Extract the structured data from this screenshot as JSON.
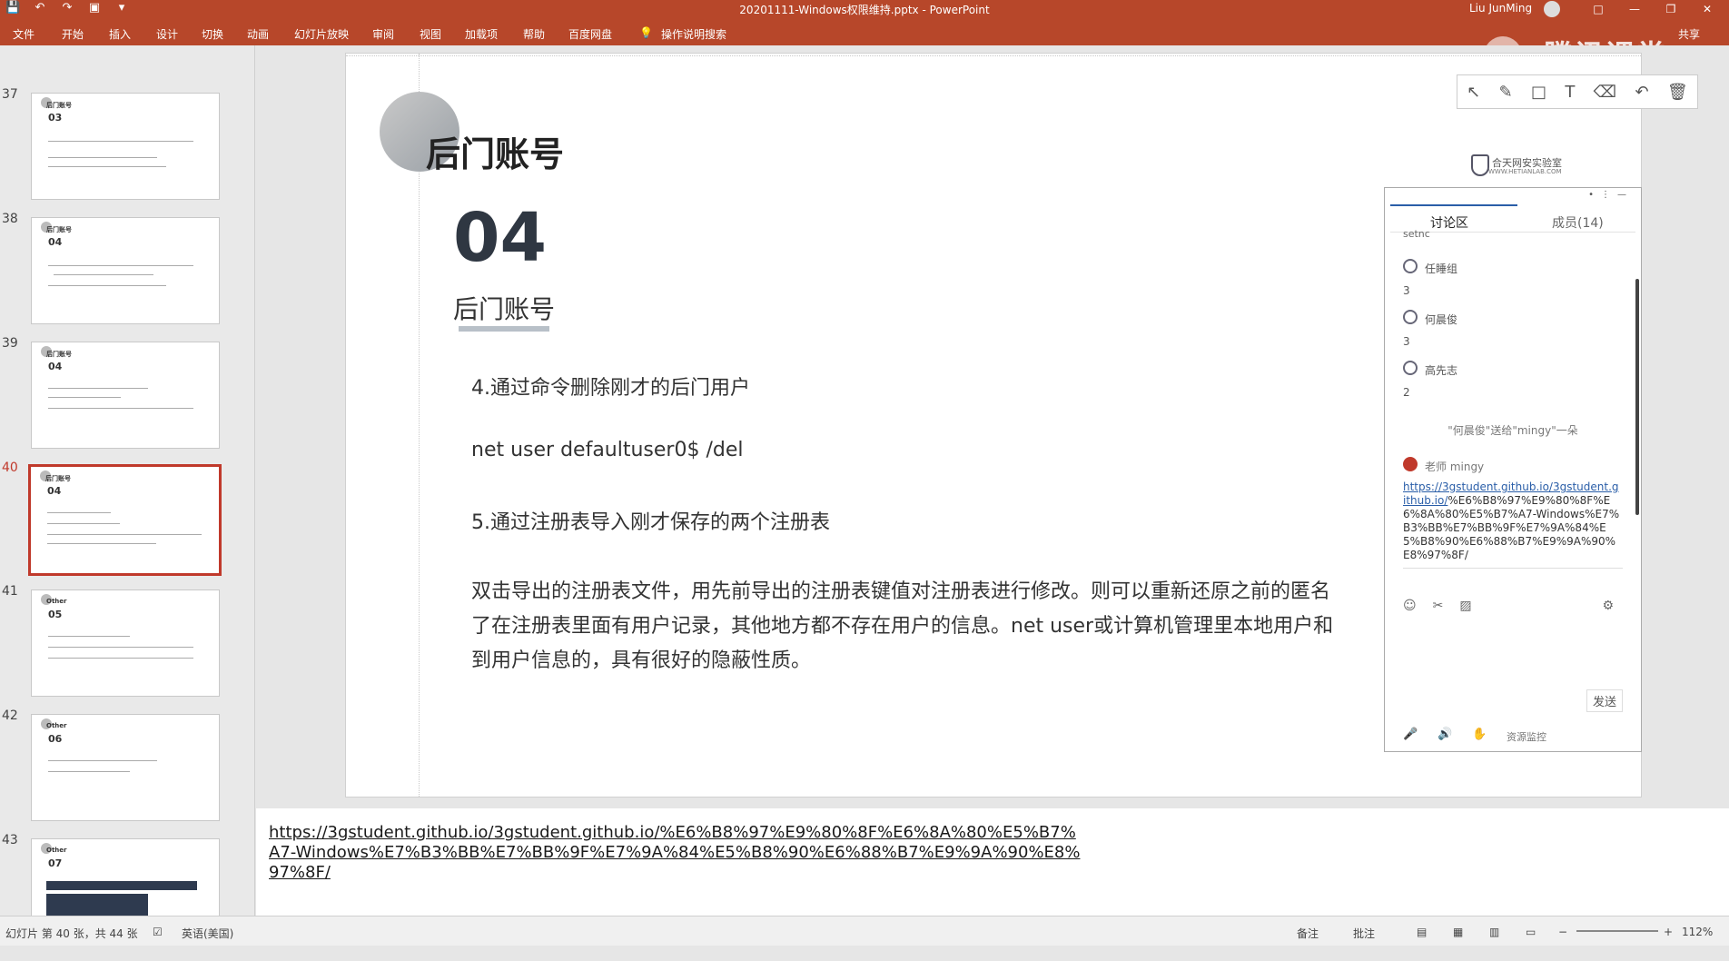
{
  "titlebar": {
    "doc_title": "20201111-Windows权限维持.pptx  -  PowerPoint",
    "user": "Liu JunMing",
    "quick_access": [
      "save-icon",
      "undo-icon",
      "redo-icon",
      "start-presentation-icon",
      "customize-icon"
    ],
    "win_buttons": [
      "□",
      "—",
      "❐",
      "✕"
    ]
  },
  "ribbon": {
    "tabs": [
      "文件",
      "开始",
      "插入",
      "设计",
      "切换",
      "动画",
      "幻灯片放映",
      "审阅",
      "视图",
      "加载项",
      "帮助",
      "百度网盘",
      "操作说明搜索"
    ],
    "share": "共享"
  },
  "watermark": "腾讯课堂",
  "thumbnails": [
    {
      "num": "37",
      "label": "后门账号",
      "section": "03",
      "selected": false
    },
    {
      "num": "38",
      "label": "后门账号",
      "section": "04",
      "selected": false
    },
    {
      "num": "39",
      "label": "后门账号",
      "section": "04",
      "selected": false
    },
    {
      "num": "40",
      "label": "后门账号",
      "section": "04",
      "selected": true
    },
    {
      "num": "41",
      "label": "Other",
      "section": "05",
      "selected": false
    },
    {
      "num": "42",
      "label": "Other",
      "section": "06",
      "selected": false
    },
    {
      "num": "43",
      "label": "Other",
      "section": "07",
      "selected": false
    }
  ],
  "slide": {
    "heading": "后门账号",
    "number": "04",
    "subtitle": "后门账号",
    "brand": "合天网安实验室",
    "brand_sub": "WWW.HETIANLAB.COM",
    "lines": [
      "4.通过命令删除刚才的后门用户",
      "net user defaultuser0$ /del",
      "5.通过注册表导入刚才保存的两个注册表",
      "双击导出的注册表文件，用先前导出的注册表键值对注册表进行修改。则可以重新还原之前的匿名",
      "了在注册表里面有用户记录，其他地方都不存在用户的信息。net user或计算机管理里本地用户和",
      "到用户信息的，具有很好的隐蔽性质。"
    ]
  },
  "annotation_toolbar": [
    "pointer-icon",
    "pen-icon",
    "rectangle-icon",
    "text-icon",
    "eraser-icon",
    "undo-icon",
    "delete-icon"
  ],
  "chat": {
    "tab_discussion": "讨论区",
    "tab_members": "成员(14)",
    "fragment": "setnc",
    "entries": [
      {
        "name": "任睡组",
        "msg": "3"
      },
      {
        "name": "何晨俊",
        "msg": "3"
      },
      {
        "name": "高先志",
        "msg": "2"
      }
    ],
    "notice": "\"何晨俊\"送给\"mingy\"一朵",
    "teacher": "老师  mingy",
    "url_link": "https://3gstudent.github.io/3gstudent.github.io/",
    "url_rest": "%E6%B8%97%E9%80%8F%E6%8A%80%E5%B7%A7-Windows%E7%B3%BB%E7%BB%9F%E7%9A%84%E5%B8%90%E6%88%B7%E9%9A%90%E8%97%8F/",
    "send": "发送",
    "monitor": "资源监控"
  },
  "notes": {
    "link": "https://3gstudent.github.io/3gstudent.github.io/%E6%B8%97%E9%80%8F%E6%8A%80%E5%B7%A7-Windows%E7%B3%BB%E7%BB%9F%E7%9A%84%E5%B8%90%E6%88%B7%E9%9A%90%E8%97%8F/"
  },
  "status": {
    "slide_info": "幻灯片 第 40 张，共 44 张",
    "language": "英语(美国)",
    "notes_btn": "备注",
    "comments_btn": "批注",
    "zoom": "112%"
  },
  "colors": {
    "accent": "#b7472a",
    "selected": "#c0392b",
    "link": "#2a5ea8"
  }
}
